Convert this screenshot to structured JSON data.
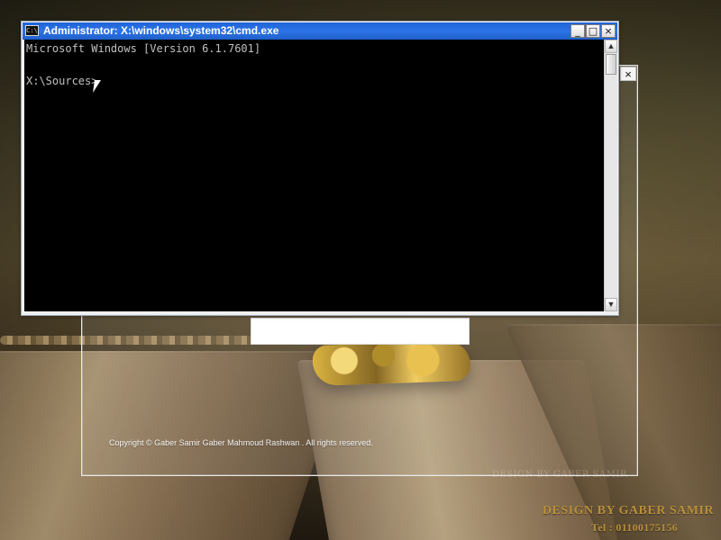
{
  "background_window": {
    "close_label": "×",
    "copyright": "Copyright © Gaber Samir Gaber Mahmoud Rashwan . All rights reserved.",
    "ghost_signature": "DESIGN BY GABER SAMIR"
  },
  "cmd": {
    "title": "Administrator: X:\\windows\\system32\\cmd.exe",
    "icon_label": "C:\\",
    "controls": {
      "minimize": "_",
      "maximize": "□",
      "close": "×"
    },
    "lines": [
      "Microsoft Windows [Version 6.1.7601]",
      "X:\\Sources>"
    ],
    "scrollbar": {
      "up": "▲",
      "down": "▼"
    }
  },
  "watermark": {
    "title": "DESIGN BY GABER SAMIR",
    "phone": "Tel : 01100175156"
  }
}
